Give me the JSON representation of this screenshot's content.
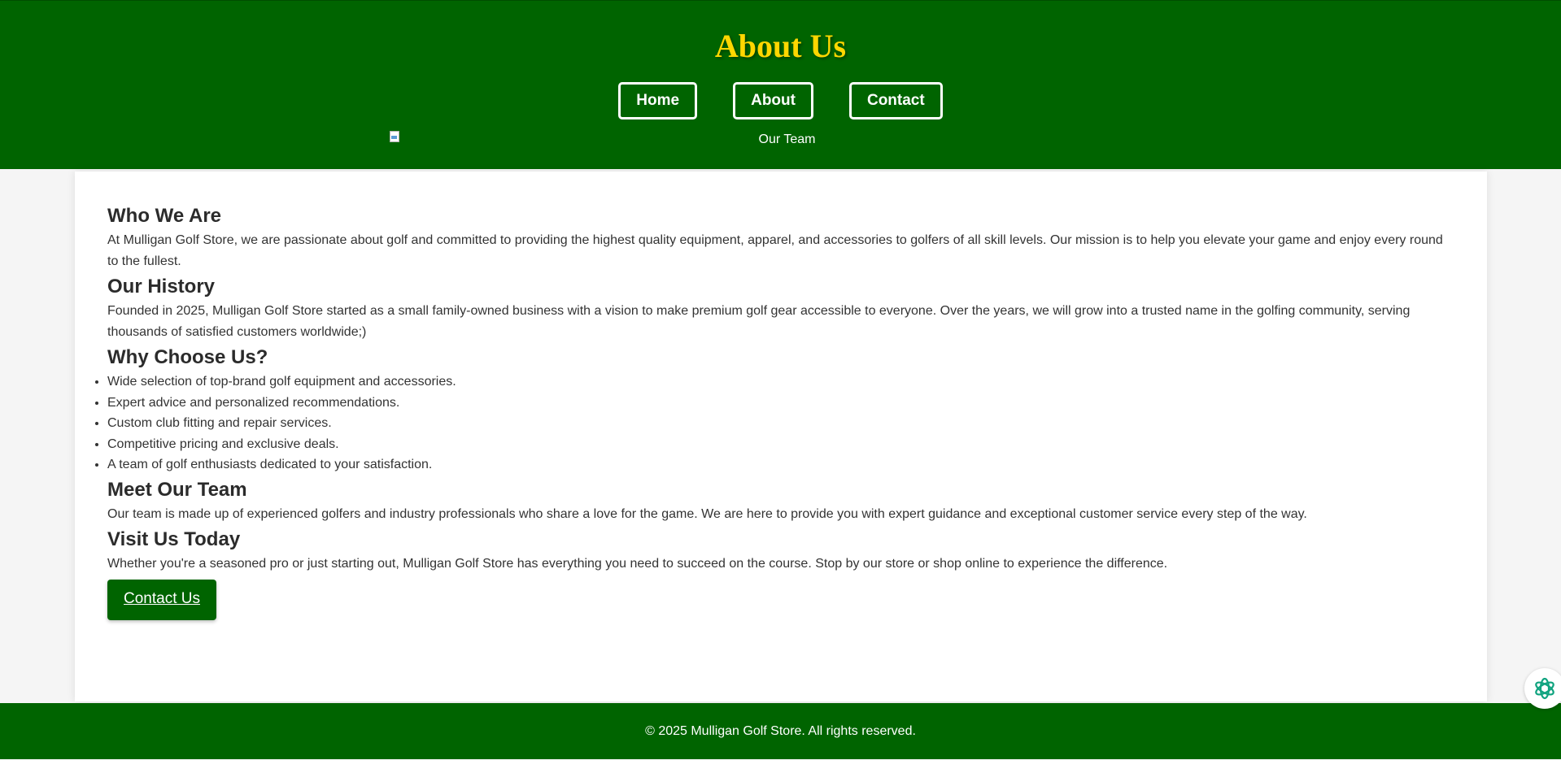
{
  "header": {
    "title": "About Us",
    "nav": [
      {
        "label": "Home"
      },
      {
        "label": "About"
      },
      {
        "label": "Contact"
      }
    ],
    "team_image": {
      "alt": "Our Team"
    }
  },
  "sections": {
    "who_we_are": {
      "heading": "Who We Are",
      "text": "At Mulligan Golf Store, we are passionate about golf and committed to providing the highest quality equipment, apparel, and accessories to golfers of all skill levels. Our mission is to help you elevate your game and enjoy every round to the fullest."
    },
    "history": {
      "heading": "Our History",
      "text": "Founded in 2025, Mulligan Golf Store started as a small family-owned business with a vision to make premium golf gear accessible to everyone. Over the years, we will grow into a trusted name in the golfing community, serving thousands of satisfied customers worldwide;)"
    },
    "why": {
      "heading": "Why Choose Us?",
      "items": [
        "Wide selection of top-brand golf equipment and accessories.",
        "Expert advice and personalized recommendations.",
        "Custom club fitting and repair services.",
        "Competitive pricing and exclusive deals.",
        "A team of golf enthusiasts dedicated to your satisfaction."
      ]
    },
    "team": {
      "heading": "Meet Our Team",
      "text": "Our team is made up of experienced golfers and industry professionals who share a love for the game. We are here to provide you with expert guidance and exceptional customer service every step of the way."
    },
    "visit": {
      "heading": "Visit Us Today",
      "text": "Whether you're a seasoned pro or just starting out, Mulligan Golf Store has everything you need to succeed on the course. Stop by our store or shop online to experience the difference.",
      "cta_label": "Contact Us"
    }
  },
  "footer": {
    "text": "© 2025 Mulligan Golf Store. All rights reserved."
  },
  "colors": {
    "brand_green": "#006400",
    "title_gold": "#ffd700"
  },
  "icons": {
    "broken_image": "broken-image-icon",
    "assistant": "assistant-icon"
  }
}
